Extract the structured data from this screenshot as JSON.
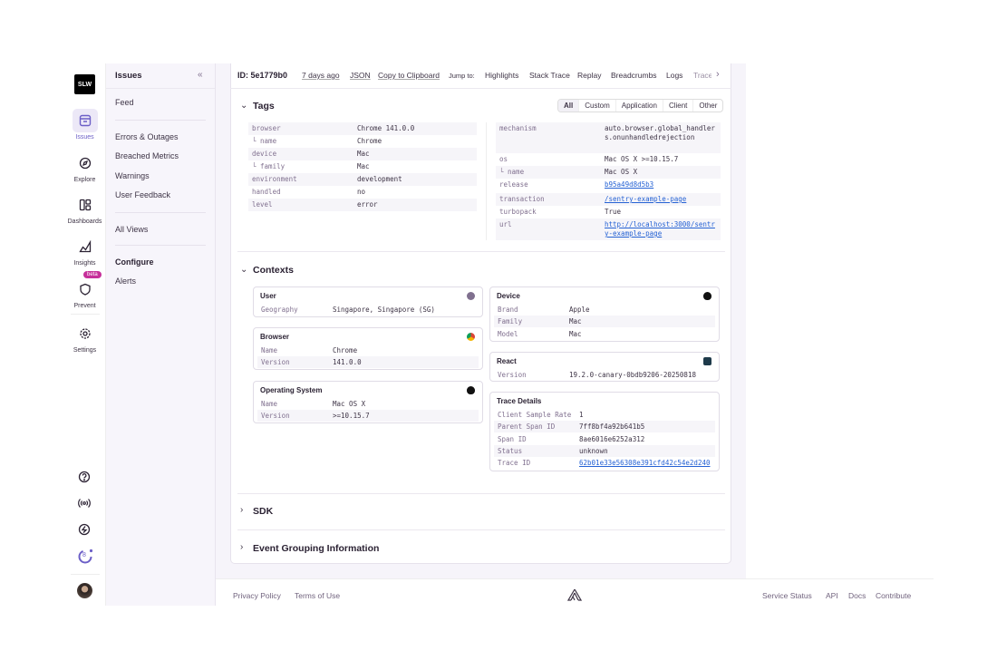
{
  "rail": {
    "logo": "SLW",
    "items": [
      {
        "label": "Issues",
        "icon": "inbox-icon"
      },
      {
        "label": "Explore",
        "icon": "compass-icon"
      },
      {
        "label": "Dashboards",
        "icon": "dashboard-icon"
      },
      {
        "label": "Insights",
        "icon": "chart-icon"
      },
      {
        "label": "Prevent",
        "icon": "shield-icon"
      },
      {
        "label": "Settings",
        "icon": "gear-icon"
      }
    ],
    "beta": "beta",
    "onboarding_count": "8"
  },
  "sidebar": {
    "title": "Issues",
    "feed": "Feed",
    "items": [
      "Errors & Outages",
      "Breached Metrics",
      "Warnings",
      "User Feedback"
    ],
    "all_views": "All Views",
    "configure": "Configure",
    "alerts": "Alerts"
  },
  "header": {
    "id": "ID: 5e1779b0",
    "age": "7 days ago",
    "json": "JSON",
    "copy": "Copy to Clipboard",
    "jump": "Jump to:",
    "jump_links": [
      "Highlights",
      "Stack Trace",
      "Replay",
      "Breadcrumbs",
      "Logs",
      "Trace"
    ]
  },
  "tags": {
    "title": "Tags",
    "filters": [
      "All",
      "Custom",
      "Application",
      "Client",
      "Other"
    ],
    "left": [
      [
        "browser",
        "Chrome 141.0.0"
      ],
      [
        "└ name",
        "Chrome"
      ],
      [
        "device",
        "Mac"
      ],
      [
        "└ family",
        "Mac"
      ],
      [
        "environment",
        "development"
      ],
      [
        "handled",
        "no"
      ],
      [
        "level",
        "error"
      ]
    ],
    "right": [
      [
        "mechanism",
        "auto.browser.global_handlers.onunhandledrejection"
      ],
      [
        "os",
        "Mac OS X >=10.15.7"
      ],
      [
        "└ name",
        "Mac OS X"
      ],
      [
        "release",
        "b95a49d8d5b3"
      ],
      [
        "transaction",
        "/sentry-example-page"
      ],
      [
        "turbopack",
        "True"
      ],
      [
        "url",
        "http://localhost:3000/sentry-example-page"
      ]
    ]
  },
  "contexts": {
    "title": "Contexts",
    "user": {
      "title": "User",
      "rows": [
        [
          "Geography",
          "Singapore, Singapore (SG)"
        ]
      ]
    },
    "browser": {
      "title": "Browser",
      "rows": [
        [
          "Name",
          "Chrome"
        ],
        [
          "Version",
          "141.0.0"
        ]
      ]
    },
    "os": {
      "title": "Operating System",
      "rows": [
        [
          "Name",
          "Mac OS X"
        ],
        [
          "Version",
          ">=10.15.7"
        ]
      ]
    },
    "device": {
      "title": "Device",
      "rows": [
        [
          "Brand",
          "Apple"
        ],
        [
          "Family",
          "Mac"
        ],
        [
          "Model",
          "Mac"
        ]
      ]
    },
    "react": {
      "title": "React",
      "rows": [
        [
          "Version",
          "19.2.0-canary-0bdb9206-20250818"
        ]
      ]
    },
    "trace": {
      "title": "Trace Details",
      "rows": [
        [
          "Client Sample Rate",
          "1"
        ],
        [
          "Parent Span ID",
          "7ff8bf4a92b641b5"
        ],
        [
          "Span ID",
          "8ae6016e6252a312"
        ],
        [
          "Status",
          "unknown"
        ],
        [
          "Trace ID",
          "62b01e33e56308e391cfd42c54e2d240"
        ]
      ]
    }
  },
  "sdk": "SDK",
  "grouping": "Event Grouping Information",
  "footer": {
    "privacy": "Privacy Policy",
    "terms": "Terms of Use",
    "links": [
      "Service Status",
      "API",
      "Docs",
      "Contribute"
    ]
  }
}
